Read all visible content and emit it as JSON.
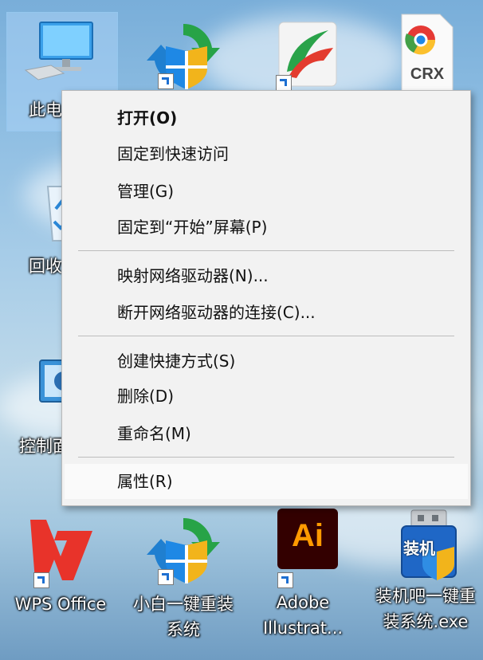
{
  "desktop": {
    "icons": [
      {
        "label": "此电脑"
      },
      {
        "label": ""
      },
      {
        "label": ""
      },
      {
        "label": ""
      },
      {
        "label": "回收站"
      },
      {
        "label": "控制面板"
      },
      {
        "label": "WPS Office"
      },
      {
        "label": "小白一键重装\n系统"
      },
      {
        "label": "Adobe\nIllustrat..."
      },
      {
        "label": "装机吧一键重\n装系统.exe"
      }
    ],
    "crx_text": "CRX",
    "ai_text": "Ai",
    "zhuangji_text": "装机"
  },
  "context_menu": {
    "items": [
      {
        "label": "打开(O)"
      },
      {
        "label": "固定到快速访问"
      },
      {
        "label": "管理(G)"
      },
      {
        "label": "固定到“开始”屏幕(P)"
      },
      {
        "label": "映射网络驱动器(N)..."
      },
      {
        "label": "断开网络驱动器的连接(C)..."
      },
      {
        "label": "创建快捷方式(S)"
      },
      {
        "label": "删除(D)"
      },
      {
        "label": "重命名(M)"
      },
      {
        "label": "属性(R)"
      }
    ]
  },
  "colors": {
    "wps_red": "#e8332a",
    "ai_bg": "#330000",
    "ai_orange": "#ff9a00"
  }
}
